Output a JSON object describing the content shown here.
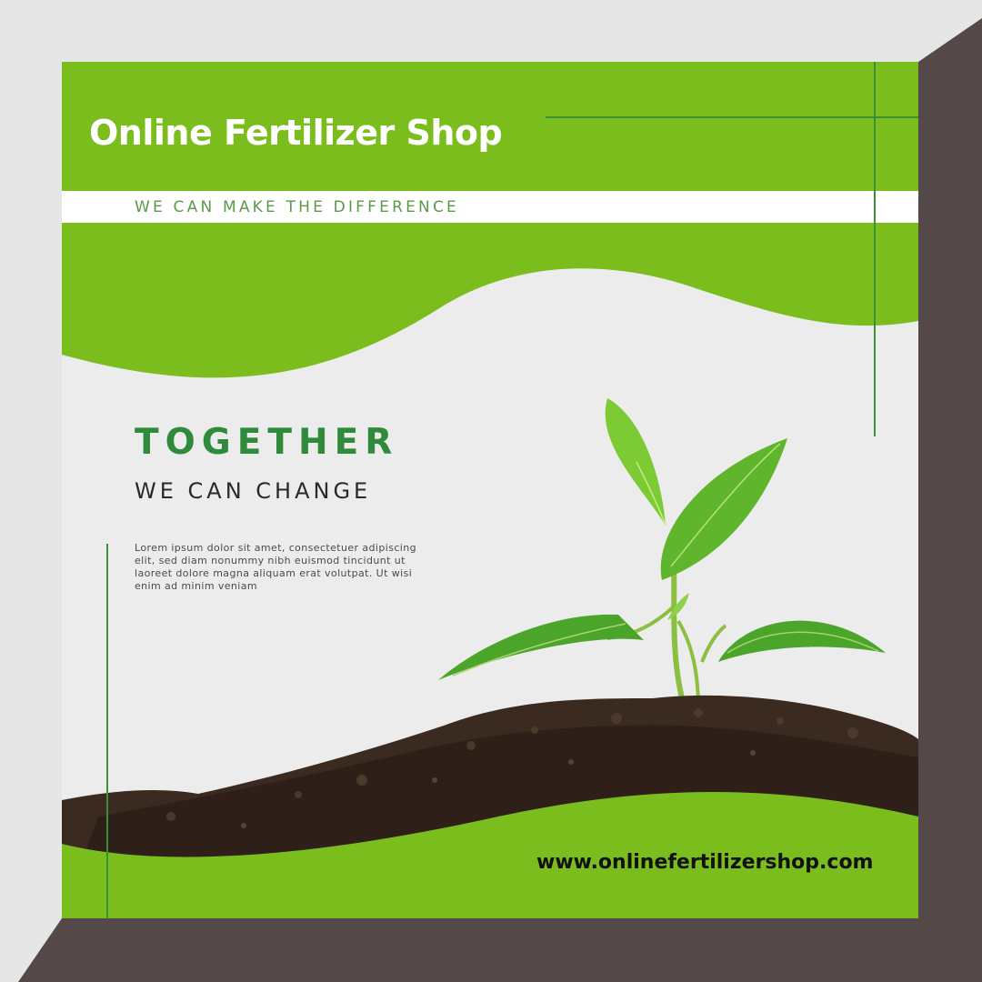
{
  "brand": {
    "name": "Online Fertilizer Shop"
  },
  "tagline": "WE CAN MAKE THE DIFFERENCE",
  "headline": "TOGETHER",
  "subheadline": "WE CAN CHANGE",
  "body_text": "Lorem ipsum dolor sit amet, consectetuer adipiscing elit, sed diam nonummy nibh euismod tincidunt ut laoreet dolore magna aliquam erat volutpat. Ut wisi enim ad minim veniam",
  "website": "www.onlinefertilizershop.com",
  "colors": {
    "brand_green": "#7cbd1e",
    "dark_green": "#2f8a3c",
    "line_green": "#3a8f3a",
    "frame_light": "#e6e6e6",
    "frame_dark": "#554848",
    "panel": "#ececec",
    "soil": "#3a2a20"
  },
  "illustration": {
    "name": "seedling-in-soil"
  }
}
